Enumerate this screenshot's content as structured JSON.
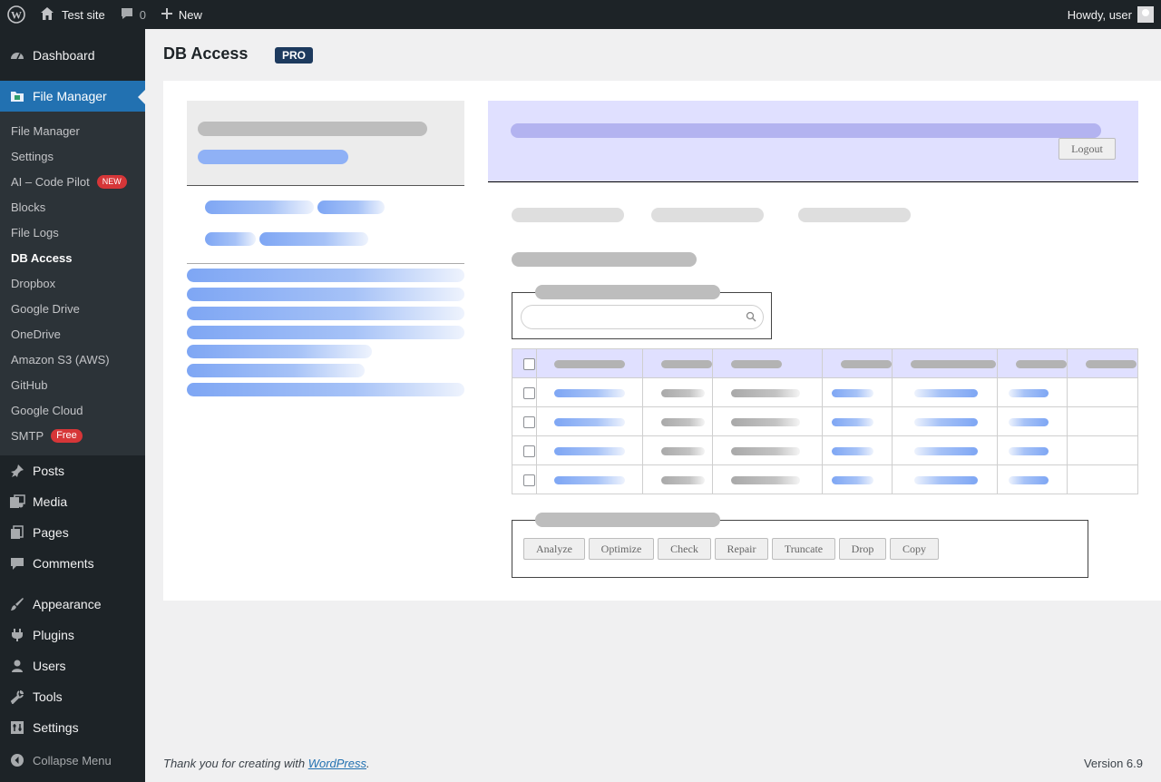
{
  "admin_bar": {
    "site_name": "Test site",
    "comments_count": "0",
    "new_label": "New",
    "greeting": "Howdy, user"
  },
  "sidebar": {
    "top_items": [
      {
        "label": "Dashboard",
        "icon": "dashboard-icon"
      },
      {
        "label": "File Manager",
        "icon": "file-manager-icon",
        "current": true
      }
    ],
    "submenu": [
      {
        "label": "File Manager"
      },
      {
        "label": "Settings"
      },
      {
        "label": "AI – Code Pilot",
        "badge": "NEW"
      },
      {
        "label": "Blocks"
      },
      {
        "label": "File Logs"
      },
      {
        "label": "DB Access",
        "current": true
      },
      {
        "label": "Dropbox"
      },
      {
        "label": "Google Drive"
      },
      {
        "label": "OneDrive"
      },
      {
        "label": "Amazon S3 (AWS)"
      },
      {
        "label": "GitHub"
      },
      {
        "label": "Google Cloud"
      },
      {
        "label": "SMTP",
        "badge": "Free"
      }
    ],
    "items": [
      {
        "label": "Posts",
        "icon": "pushpin-icon"
      },
      {
        "label": "Media",
        "icon": "media-icon"
      },
      {
        "label": "Pages",
        "icon": "pages-icon"
      },
      {
        "label": "Comments",
        "icon": "comments-icon"
      },
      {
        "label": "Appearance",
        "icon": "brush-icon"
      },
      {
        "label": "Plugins",
        "icon": "plugin-icon"
      },
      {
        "label": "Users",
        "icon": "users-icon"
      },
      {
        "label": "Tools",
        "icon": "wrench-icon"
      },
      {
        "label": "Settings",
        "icon": "settings-icon"
      }
    ],
    "collapse_label": "Collapse Menu"
  },
  "page": {
    "title": "DB Access",
    "badge": "PRO",
    "logout_label": "Logout"
  },
  "operations": {
    "buttons": [
      "Analyze",
      "Optimize",
      "Check",
      "Repair",
      "Truncate",
      "Drop",
      "Copy"
    ]
  },
  "footer": {
    "thanks_prefix": "Thank you for creating with ",
    "thanks_link": "WordPress",
    "thanks_suffix": ".",
    "version": "Version 6.9"
  },
  "colors": {
    "admin_bar": "#1d2327",
    "accent": "#2271b1",
    "badge_red": "#d63638",
    "header_lavender": "#e0e0ff"
  }
}
